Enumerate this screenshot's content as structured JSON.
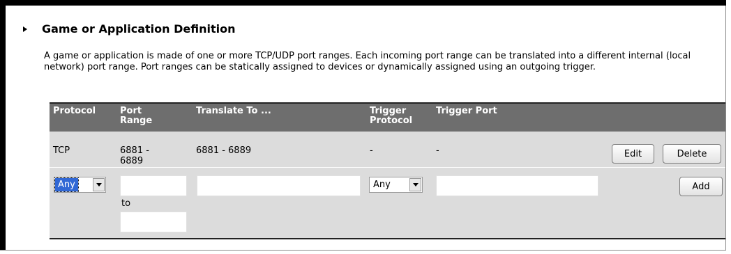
{
  "section": {
    "title": "Game or Application Definition",
    "description": "A game or application is made of one or more TCP/UDP port ranges. Each incoming port range can be translated into a different internal (local network) port range. Port ranges can be statically assigned to devices or dynamically assigned using an outgoing trigger."
  },
  "table": {
    "headers": {
      "protocol": "Protocol",
      "port_range_1": "Port",
      "port_range_2": "Range",
      "translate_to": "Translate To ...",
      "trigger_protocol_1": "Trigger",
      "trigger_protocol_2": "Protocol",
      "trigger_port": "Trigger Port"
    },
    "rows": [
      {
        "protocol": "TCP",
        "port_range_1": "6881 -",
        "port_range_2": "6889",
        "translate_to": "6881 - 6889",
        "trigger_protocol": "-",
        "trigger_port": "-",
        "edit_label": "Edit",
        "delete_label": "Delete"
      }
    ],
    "new_row": {
      "protocol_selected": "Any",
      "port_from_value": "",
      "to_label": "to",
      "port_to_value": "",
      "translate_to_value": "",
      "trigger_protocol_selected": "Any",
      "trigger_port_value": "",
      "add_label": "Add"
    }
  },
  "colors": {
    "header_bg": "#6e6e6e",
    "row_bg": "#dcdcdc",
    "select_highlight": "#3168d5"
  }
}
